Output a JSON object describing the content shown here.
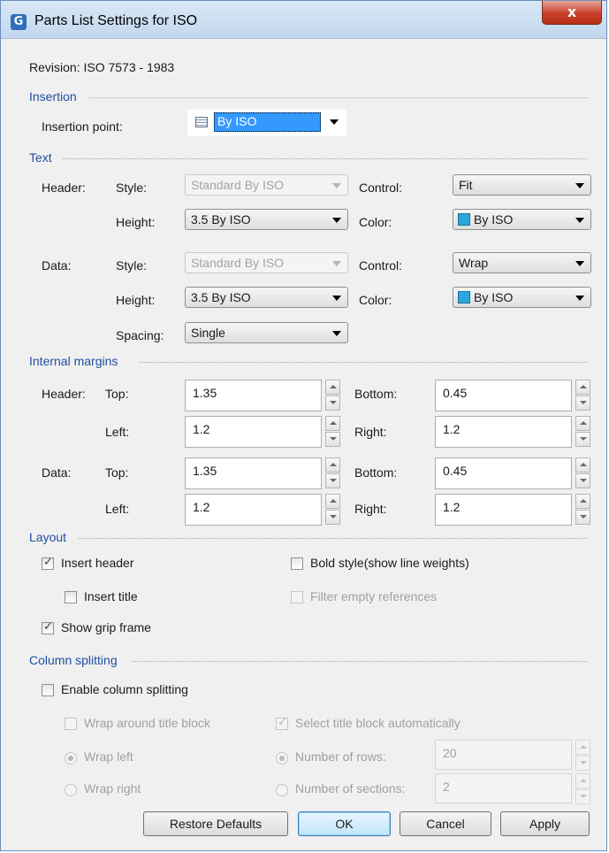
{
  "window": {
    "title": "Parts List Settings for ISO",
    "close_glyph": "x"
  },
  "revision": "Revision: ISO 7573 - 1983",
  "insertion": {
    "group_label": "Insertion",
    "point_label": "Insertion point:",
    "point_value": "By ISO"
  },
  "text": {
    "group_label": "Text",
    "header_label": "Header:",
    "data_label": "Data:",
    "style_label": "Style:",
    "height_label": "Height:",
    "control_label": "Control:",
    "color_label": "Color:",
    "spacing_label": "Spacing:",
    "header": {
      "style": "Standard By ISO",
      "height": "3.5 By ISO",
      "control": "Fit",
      "color": "By ISO"
    },
    "data": {
      "style": "Standard By ISO",
      "height": "3.5 By ISO",
      "control": "Wrap",
      "color": "By ISO",
      "spacing": "Single"
    },
    "swatch_color": "#2aa7db"
  },
  "margins": {
    "group_label": "Internal margins",
    "header_label": "Header:",
    "data_label": "Data:",
    "top_label": "Top:",
    "bottom_label": "Bottom:",
    "left_label": "Left:",
    "right_label": "Right:",
    "header": {
      "top": "1.35",
      "bottom": "0.45",
      "left": "1.2",
      "right": "1.2"
    },
    "data": {
      "top": "1.35",
      "bottom": "0.45",
      "left": "1.2",
      "right": "1.2"
    }
  },
  "layout": {
    "group_label": "Layout",
    "insert_header": {
      "label": "Insert header",
      "checked": true
    },
    "bold_style": {
      "label": "Bold style(show line weights)",
      "checked": false
    },
    "insert_title": {
      "label": "Insert title",
      "checked": false
    },
    "filter_empty": {
      "label": "Filter empty references",
      "checked": false,
      "disabled": true
    },
    "show_grip": {
      "label": "Show grip frame",
      "checked": true
    }
  },
  "column_splitting": {
    "group_label": "Column splitting",
    "enable": {
      "label": "Enable column splitting",
      "checked": false
    },
    "wrap_around": {
      "label": "Wrap around title block",
      "checked": false
    },
    "select_auto": {
      "label": "Select title block automatically",
      "checked": true
    },
    "wrap_left": {
      "label": "Wrap left",
      "selected": true
    },
    "wrap_right": {
      "label": "Wrap right",
      "selected": false
    },
    "num_rows": {
      "label": "Number of rows:",
      "selected": true,
      "value": "20"
    },
    "num_sections": {
      "label": "Number of sections:",
      "selected": false,
      "value": "2"
    }
  },
  "buttons": {
    "restore": "Restore Defaults",
    "ok": "OK",
    "cancel": "Cancel",
    "apply": "Apply"
  },
  "icons": [
    "app-logo-icon",
    "close-icon",
    "insertion-table-icon",
    "dropdown-arrow-icon",
    "spin-up-icon",
    "spin-down-icon"
  ]
}
